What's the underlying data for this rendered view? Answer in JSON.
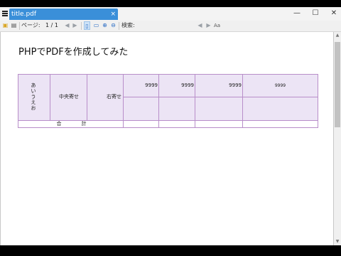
{
  "window": {
    "tab_title": "title.pdf",
    "tab_close": "×",
    "minimize": "—",
    "maximize": "☐",
    "close": "✕"
  },
  "toolbar": {
    "page_label": "ページ:",
    "page_value": "1 / 1",
    "search_label": "検索:",
    "prev_result": "◀",
    "next_result": "▶",
    "match_case": "Aa"
  },
  "document": {
    "title": "PHPでPDFを作成してみた",
    "table": {
      "vertical_text": [
        "あ",
        "い",
        "う",
        "え",
        "お"
      ],
      "center_cell": "中央寄せ",
      "right_cell": "右寄せ",
      "values": [
        "9999",
        "9999",
        "9999",
        "9999"
      ],
      "total_label_1": "合",
      "total_label_2": "計"
    }
  }
}
